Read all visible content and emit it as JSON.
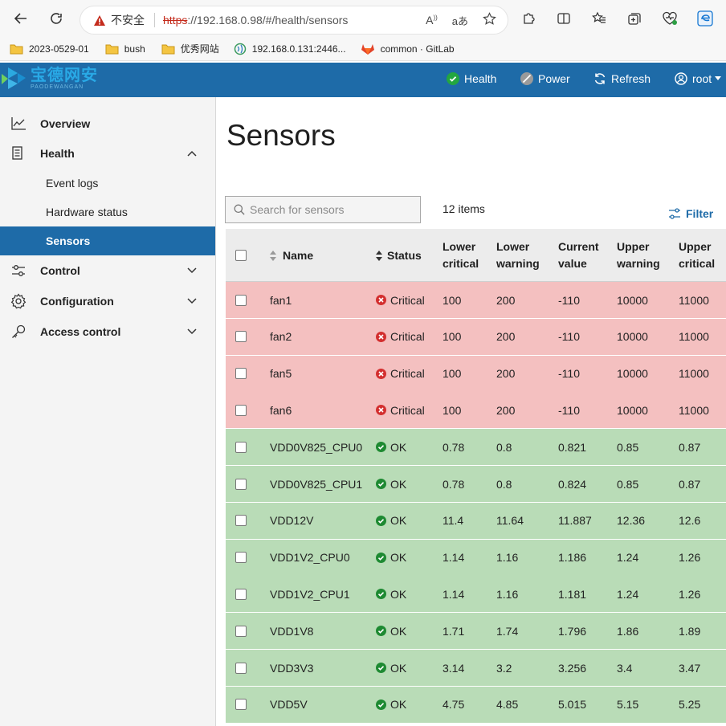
{
  "browser": {
    "insecure_label": "不安全",
    "url_scheme": "https",
    "url_rest": "://192.168.0.98/#/health/sensors",
    "bookmarks": [
      {
        "label": "2023-0529-01",
        "icon": "folder-icon"
      },
      {
        "label": "bush",
        "icon": "folder-icon"
      },
      {
        "label": "优秀网站",
        "icon": "folder-icon"
      },
      {
        "label": "192.168.0.131:2446...",
        "icon": "site-icon"
      },
      {
        "label": "common · GitLab",
        "icon": "gitlab-icon"
      }
    ]
  },
  "header": {
    "logo_cn": "宝德网安",
    "logo_en": "PAODEWANGAN",
    "health_label": "Health",
    "power_label": "Power",
    "refresh_label": "Refresh",
    "user_label": "root",
    "colors": {
      "bar": "#1e6ba8",
      "ok": "#23a640",
      "power": "#9a9a9a"
    }
  },
  "sidebar": {
    "overview": "Overview",
    "health": "Health",
    "event_logs": "Event logs",
    "hardware_status": "Hardware status",
    "sensors": "Sensors",
    "control": "Control",
    "configuration": "Configuration",
    "access_control": "Access control"
  },
  "main": {
    "title": "Sensors",
    "search_placeholder": "Search for sensors",
    "items_count": "12 items",
    "filter_label": "Filter"
  },
  "table": {
    "headers": {
      "name": "Name",
      "status": "Status",
      "lower_critical": [
        "Lower",
        "critical"
      ],
      "lower_warning": [
        "Lower",
        "warning"
      ],
      "current_value": [
        "Current",
        "value"
      ],
      "upper_warning": [
        "Upper",
        "warning"
      ],
      "upper_critical": [
        "Upper",
        "critical"
      ]
    },
    "rows": [
      {
        "name": "fan1",
        "status": "Critical",
        "lc": "100",
        "lw": "200",
        "cur": "-110",
        "uw": "10000",
        "uc": "11000"
      },
      {
        "name": "fan2",
        "status": "Critical",
        "lc": "100",
        "lw": "200",
        "cur": "-110",
        "uw": "10000",
        "uc": "11000"
      },
      {
        "name": "fan5",
        "status": "Critical",
        "lc": "100",
        "lw": "200",
        "cur": "-110",
        "uw": "10000",
        "uc": "11000"
      },
      {
        "name": "fan6",
        "status": "Critical",
        "lc": "100",
        "lw": "200",
        "cur": "-110",
        "uw": "10000",
        "uc": "11000"
      },
      {
        "name": "VDD0V825_CPU0",
        "status": "OK",
        "lc": "0.78",
        "lw": "0.8",
        "cur": "0.821",
        "uw": "0.85",
        "uc": "0.87"
      },
      {
        "name": "VDD0V825_CPU1",
        "status": "OK",
        "lc": "0.78",
        "lw": "0.8",
        "cur": "0.824",
        "uw": "0.85",
        "uc": "0.87"
      },
      {
        "name": "VDD12V",
        "status": "OK",
        "lc": "11.4",
        "lw": "11.64",
        "cur": "11.887",
        "uw": "12.36",
        "uc": "12.6"
      },
      {
        "name": "VDD1V2_CPU0",
        "status": "OK",
        "lc": "1.14",
        "lw": "1.16",
        "cur": "1.186",
        "uw": "1.24",
        "uc": "1.26"
      },
      {
        "name": "VDD1V2_CPU1",
        "status": "OK",
        "lc": "1.14",
        "lw": "1.16",
        "cur": "1.181",
        "uw": "1.24",
        "uc": "1.26"
      },
      {
        "name": "VDD1V8",
        "status": "OK",
        "lc": "1.71",
        "lw": "1.74",
        "cur": "1.796",
        "uw": "1.86",
        "uc": "1.89"
      },
      {
        "name": "VDD3V3",
        "status": "OK",
        "lc": "3.14",
        "lw": "3.2",
        "cur": "3.256",
        "uw": "3.4",
        "uc": "3.47"
      },
      {
        "name": "VDD5V",
        "status": "OK",
        "lc": "4.75",
        "lw": "4.85",
        "cur": "5.015",
        "uw": "5.15",
        "uc": "5.25"
      }
    ],
    "colors": {
      "critical_row": "#f4c0c0",
      "ok_row": "#b9dcb7",
      "critical_icon": "#d32f2f",
      "ok_icon": "#1e8a32"
    }
  }
}
